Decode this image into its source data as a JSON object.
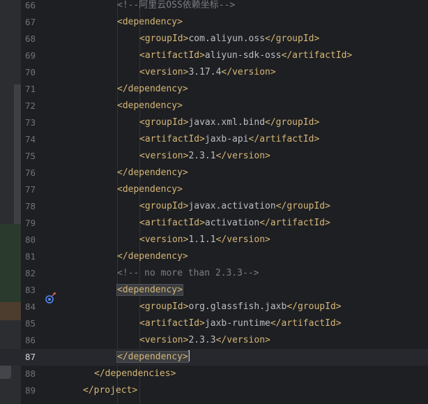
{
  "editor": {
    "current_line": "87",
    "colors": {
      "tag": "#d5b778",
      "text": "#bcbec4",
      "comment": "#7a7e85",
      "line_number": "#6f737a",
      "background": "#1e1f22"
    },
    "lines": [
      {
        "n": "66",
        "indent": 2,
        "kind": "comment",
        "text": "<!--阿里云OSS依赖坐标-->"
      },
      {
        "n": "67",
        "indent": 2,
        "kind": "open",
        "tag": "dependency"
      },
      {
        "n": "68",
        "indent": 3,
        "kind": "elem",
        "tag": "groupId",
        "value": "com.aliyun.oss"
      },
      {
        "n": "69",
        "indent": 3,
        "kind": "elem",
        "tag": "artifactId",
        "value": "aliyun-sdk-oss"
      },
      {
        "n": "70",
        "indent": 3,
        "kind": "elem",
        "tag": "version",
        "value": "3.17.4"
      },
      {
        "n": "71",
        "indent": 2,
        "kind": "close",
        "tag": "dependency"
      },
      {
        "n": "72",
        "indent": 2,
        "kind": "open",
        "tag": "dependency"
      },
      {
        "n": "73",
        "indent": 3,
        "kind": "elem",
        "tag": "groupId",
        "value": "javax.xml.bind"
      },
      {
        "n": "74",
        "indent": 3,
        "kind": "elem",
        "tag": "artifactId",
        "value": "jaxb-api"
      },
      {
        "n": "75",
        "indent": 3,
        "kind": "elem",
        "tag": "version",
        "value": "2.3.1"
      },
      {
        "n": "76",
        "indent": 2,
        "kind": "close",
        "tag": "dependency"
      },
      {
        "n": "77",
        "indent": 2,
        "kind": "open",
        "tag": "dependency"
      },
      {
        "n": "78",
        "indent": 3,
        "kind": "elem",
        "tag": "groupId",
        "value": "javax.activation"
      },
      {
        "n": "79",
        "indent": 3,
        "kind": "elem",
        "tag": "artifactId",
        "value": "activation"
      },
      {
        "n": "80",
        "indent": 3,
        "kind": "elem",
        "tag": "version",
        "value": "1.1.1"
      },
      {
        "n": "81",
        "indent": 2,
        "kind": "close",
        "tag": "dependency"
      },
      {
        "n": "82",
        "indent": 2,
        "kind": "comment",
        "text": "<!-- no more than 2.3.3-->"
      },
      {
        "n": "83",
        "indent": 2,
        "kind": "open",
        "tag": "dependency",
        "matched": true
      },
      {
        "n": "84",
        "indent": 3,
        "kind": "elem",
        "tag": "groupId",
        "value": "org.glassfish.jaxb"
      },
      {
        "n": "85",
        "indent": 3,
        "kind": "elem",
        "tag": "artifactId",
        "value": "jaxb-runtime"
      },
      {
        "n": "86",
        "indent": 3,
        "kind": "elem",
        "tag": "version",
        "value": "2.3.3"
      },
      {
        "n": "87",
        "indent": 2,
        "kind": "close",
        "tag": "dependency",
        "matched": true,
        "caret": true
      },
      {
        "n": "88",
        "indent": 1,
        "kind": "close",
        "tag": "dependencies"
      },
      {
        "n": "89",
        "indent": 0,
        "kind": "close",
        "tag": "project"
      }
    ],
    "gutter_icon": "override-method-icon"
  }
}
